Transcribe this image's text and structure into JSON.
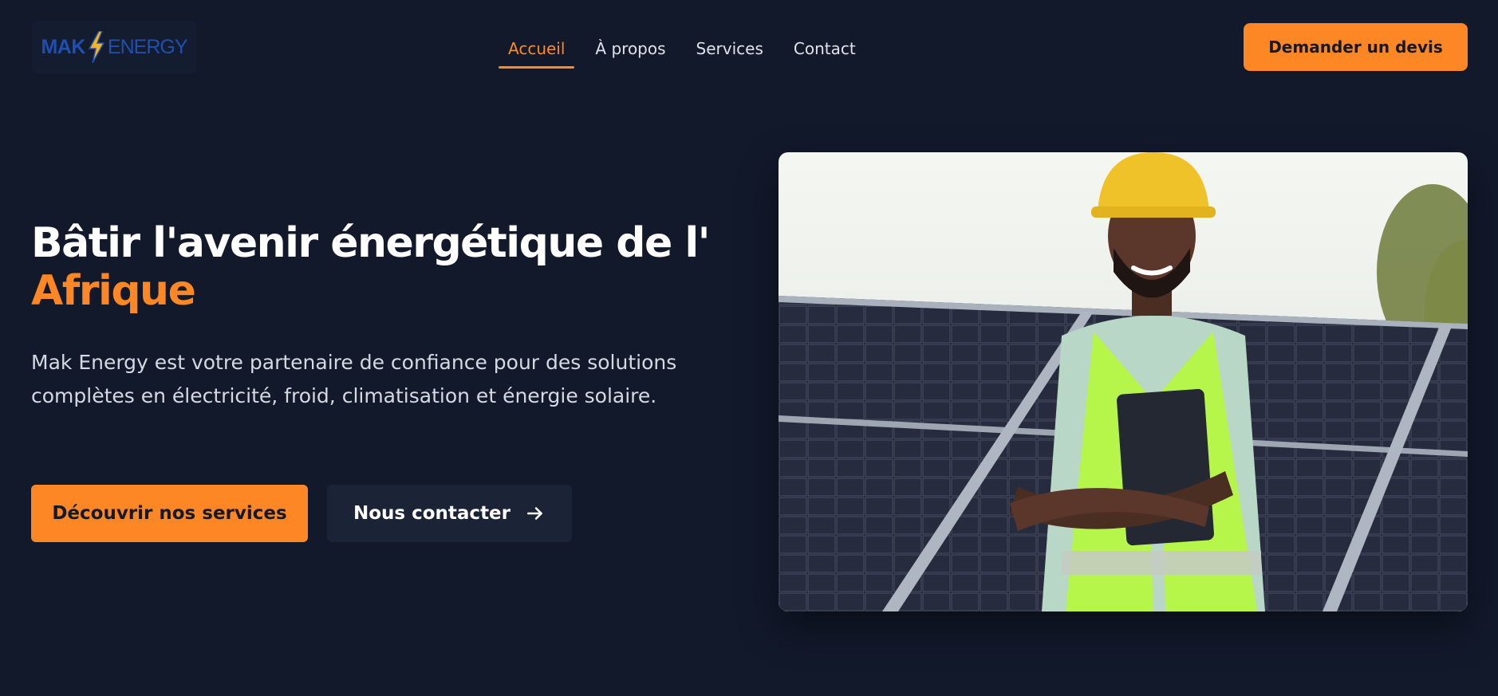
{
  "brand": {
    "logo_part1": "MAK",
    "logo_part2": "ENERGY",
    "logo_color": "#1f4fb0",
    "bolt_color": "#f4b41a"
  },
  "nav": {
    "items": [
      {
        "label": "Accueil",
        "active": true
      },
      {
        "label": "À propos",
        "active": false
      },
      {
        "label": "Services",
        "active": false
      },
      {
        "label": "Contact",
        "active": false
      }
    ]
  },
  "header": {
    "cta_label": "Demander un devis"
  },
  "hero": {
    "title_line1": "Bâtir l'avenir énergétique de l'",
    "title_line2": "Afrique",
    "description": "Mak Energy est votre partenaire de confiance pour des solutions complètes en électricité, froid, climatisation et énergie solaire.",
    "primary_button": "Découvrir nos services",
    "secondary_button": "Nous contacter",
    "secondary_icon": "arrow-right-icon",
    "image_subject": "worker-with-solar-panels-photo"
  },
  "colors": {
    "background": "#12192b",
    "accent": "#fd8625",
    "secondary_button_bg": "#1b2436"
  }
}
